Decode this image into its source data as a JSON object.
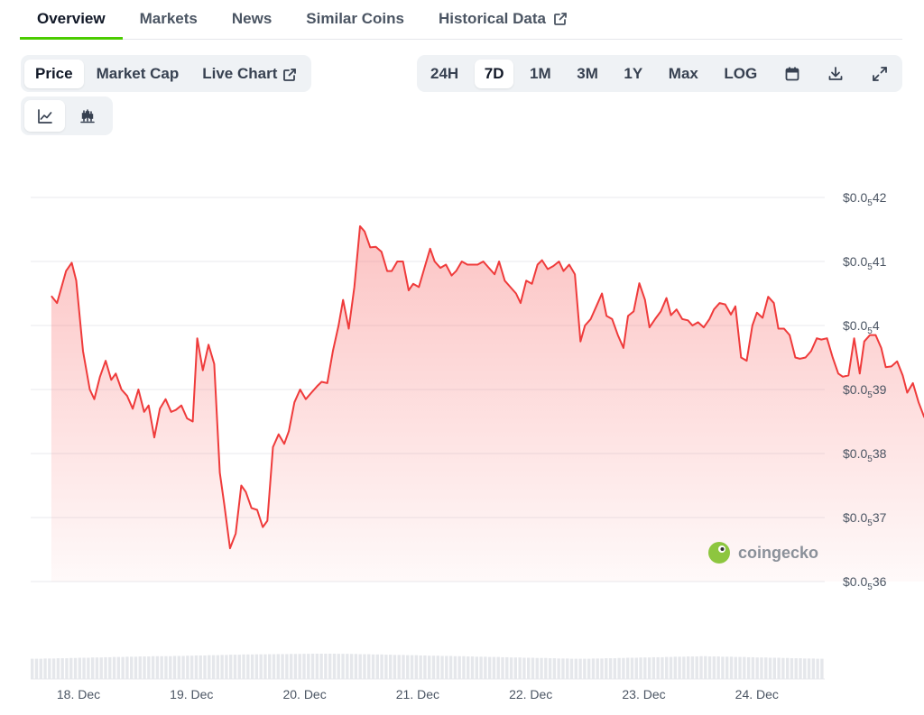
{
  "nav": {
    "tabs": [
      {
        "label": "Overview",
        "active": true
      },
      {
        "label": "Markets"
      },
      {
        "label": "News"
      },
      {
        "label": "Similar Coins"
      },
      {
        "label": "Historical Data",
        "external": true
      }
    ]
  },
  "metric_tabs": [
    {
      "label": "Price",
      "active": true
    },
    {
      "label": "Market Cap"
    },
    {
      "label": "Live Chart",
      "external": true
    }
  ],
  "range_tabs": [
    {
      "label": "24H"
    },
    {
      "label": "7D",
      "active": true
    },
    {
      "label": "1M"
    },
    {
      "label": "3M"
    },
    {
      "label": "1Y"
    },
    {
      "label": "Max"
    },
    {
      "label": "LOG"
    }
  ],
  "toolbar_icons": [
    "calendar-icon",
    "download-icon",
    "expand-icon"
  ],
  "chart_type_icons": [
    "line-chart-icon",
    "candlestick-icon"
  ],
  "colors": {
    "accent": "#4bcc00",
    "line": "#ef3b3b",
    "area": "#fde2e2"
  },
  "watermark": {
    "text": "coingecko"
  },
  "chart_data": {
    "type": "line",
    "grid": true,
    "y_tick_labels": [
      {
        "value": 4.2e-06,
        "prefix": "$0.0",
        "sub": "5",
        "suffix": "42"
      },
      {
        "value": 4.1e-06,
        "prefix": "$0.0",
        "sub": "5",
        "suffix": "41"
      },
      {
        "value": 4e-06,
        "prefix": "$0.0",
        "sub": "5",
        "suffix": "4"
      },
      {
        "value": 3.9e-06,
        "prefix": "$0.0",
        "sub": "5",
        "suffix": "39"
      },
      {
        "value": 3.8e-06,
        "prefix": "$0.0",
        "sub": "5",
        "suffix": "38"
      },
      {
        "value": 3.7e-06,
        "prefix": "$0.0",
        "sub": "5",
        "suffix": "37"
      },
      {
        "value": 3.6e-06,
        "prefix": "$0.0",
        "sub": "5",
        "suffix": "36"
      }
    ],
    "ylim": [
      3.6e-06,
      4.2e-06
    ],
    "x_tick_labels": [
      "18. Dec",
      "19. Dec",
      "20. Dec",
      "21. Dec",
      "22. Dec",
      "23. Dec",
      "24. Dec"
    ],
    "x_days_range": [
      0,
      7
    ],
    "series": [
      {
        "points": [
          [
            -0.24,
            4.046
          ],
          [
            -0.19,
            4.035
          ],
          [
            -0.11,
            4.085
          ],
          [
            -0.06,
            4.098
          ],
          [
            -0.02,
            4.07
          ],
          [
            0.04,
            3.96
          ],
          [
            0.1,
            3.9
          ],
          [
            0.14,
            3.885
          ],
          [
            0.19,
            3.92
          ],
          [
            0.24,
            3.945
          ],
          [
            0.29,
            3.915
          ],
          [
            0.33,
            3.925
          ],
          [
            0.38,
            3.9
          ],
          [
            0.43,
            3.89
          ],
          [
            0.48,
            3.87
          ],
          [
            0.53,
            3.9
          ],
          [
            0.58,
            3.865
          ],
          [
            0.62,
            3.875
          ],
          [
            0.67,
            3.825
          ],
          [
            0.72,
            3.87
          ],
          [
            0.77,
            3.885
          ],
          [
            0.82,
            3.865
          ],
          [
            0.86,
            3.868
          ],
          [
            0.91,
            3.875
          ],
          [
            0.96,
            3.855
          ],
          [
            1.01,
            3.85
          ],
          [
            1.05,
            3.98
          ],
          [
            1.1,
            3.93
          ],
          [
            1.15,
            3.97
          ],
          [
            1.2,
            3.94
          ],
          [
            1.25,
            3.77
          ],
          [
            1.29,
            3.72
          ],
          [
            1.34,
            3.652
          ],
          [
            1.39,
            3.675
          ],
          [
            1.44,
            3.75
          ],
          [
            1.48,
            3.74
          ],
          [
            1.53,
            3.715
          ],
          [
            1.58,
            3.712
          ],
          [
            1.63,
            3.685
          ],
          [
            1.67,
            3.695
          ],
          [
            1.72,
            3.81
          ],
          [
            1.77,
            3.83
          ],
          [
            1.82,
            3.815
          ],
          [
            1.86,
            3.835
          ],
          [
            1.91,
            3.88
          ],
          [
            1.96,
            3.9
          ],
          [
            2.01,
            3.885
          ],
          [
            2.06,
            3.895
          ],
          [
            2.11,
            3.905
          ],
          [
            2.15,
            3.912
          ],
          [
            2.2,
            3.91
          ],
          [
            2.25,
            3.96
          ],
          [
            2.3,
            4.0
          ],
          [
            2.34,
            4.04
          ],
          [
            2.39,
            3.995
          ],
          [
            2.44,
            4.06
          ],
          [
            2.49,
            4.155
          ],
          [
            2.53,
            4.147
          ],
          [
            2.58,
            4.122
          ],
          [
            2.63,
            4.123
          ],
          [
            2.68,
            4.115
          ],
          [
            2.73,
            4.085
          ],
          [
            2.77,
            4.085
          ],
          [
            2.82,
            4.1
          ],
          [
            2.87,
            4.1
          ],
          [
            2.92,
            4.055
          ],
          [
            2.96,
            4.065
          ],
          [
            3.01,
            4.06
          ],
          [
            3.06,
            4.09
          ],
          [
            3.11,
            4.12
          ],
          [
            3.15,
            4.1
          ],
          [
            3.2,
            4.09
          ],
          [
            3.25,
            4.095
          ],
          [
            3.3,
            4.078
          ],
          [
            3.34,
            4.085
          ],
          [
            3.39,
            4.1
          ],
          [
            3.44,
            4.095
          ],
          [
            3.49,
            4.095
          ],
          [
            3.53,
            4.095
          ],
          [
            3.58,
            4.1
          ],
          [
            3.63,
            4.09
          ],
          [
            3.68,
            4.08
          ],
          [
            3.72,
            4.1
          ],
          [
            3.77,
            4.07
          ],
          [
            3.82,
            4.06
          ],
          [
            3.87,
            4.05
          ],
          [
            3.91,
            4.035
          ],
          [
            3.96,
            4.07
          ],
          [
            4.01,
            4.065
          ],
          [
            4.06,
            4.095
          ],
          [
            4.1,
            4.102
          ],
          [
            4.15,
            4.088
          ],
          [
            4.2,
            4.093
          ],
          [
            4.25,
            4.1
          ],
          [
            4.29,
            4.085
          ],
          [
            4.34,
            4.095
          ],
          [
            4.39,
            4.08
          ],
          [
            4.44,
            3.975
          ],
          [
            4.48,
            4.0
          ],
          [
            4.53,
            4.01
          ],
          [
            4.58,
            4.03
          ],
          [
            4.63,
            4.05
          ],
          [
            4.67,
            4.015
          ],
          [
            4.72,
            4.01
          ],
          [
            4.77,
            3.985
          ],
          [
            4.82,
            3.965
          ],
          [
            4.86,
            4.015
          ],
          [
            4.91,
            4.022
          ],
          [
            4.96,
            4.066
          ],
          [
            5.01,
            4.04
          ],
          [
            5.05,
            3.997
          ],
          [
            5.1,
            4.01
          ],
          [
            5.15,
            4.022
          ],
          [
            5.2,
            4.043
          ],
          [
            5.24,
            4.016
          ],
          [
            5.29,
            4.025
          ],
          [
            5.34,
            4.01
          ],
          [
            5.39,
            4.008
          ],
          [
            5.43,
            4.0
          ],
          [
            5.48,
            4.005
          ],
          [
            5.53,
            3.997
          ],
          [
            5.58,
            4.01
          ],
          [
            5.62,
            4.025
          ],
          [
            5.67,
            4.035
          ],
          [
            5.72,
            4.033
          ],
          [
            5.77,
            4.017
          ],
          [
            5.81,
            4.03
          ],
          [
            5.86,
            3.95
          ],
          [
            5.91,
            3.945
          ],
          [
            5.96,
            4.0
          ],
          [
            6.0,
            4.02
          ],
          [
            6.05,
            4.012
          ],
          [
            6.1,
            4.045
          ],
          [
            6.15,
            4.035
          ],
          [
            6.19,
            3.995
          ],
          [
            6.24,
            3.995
          ],
          [
            6.29,
            3.985
          ],
          [
            6.34,
            3.95
          ],
          [
            6.38,
            3.948
          ],
          [
            6.43,
            3.95
          ],
          [
            6.48,
            3.96
          ],
          [
            6.53,
            3.98
          ],
          [
            6.57,
            3.978
          ],
          [
            6.62,
            3.98
          ],
          [
            6.67,
            3.95
          ],
          [
            6.72,
            3.925
          ],
          [
            6.76,
            3.92
          ],
          [
            6.81,
            3.922
          ],
          [
            6.86,
            3.98
          ],
          [
            6.91,
            3.925
          ],
          [
            6.95,
            3.975
          ],
          [
            7.0,
            3.985
          ],
          [
            7.05,
            3.985
          ],
          [
            7.1,
            3.965
          ],
          [
            7.14,
            3.935
          ],
          [
            7.19,
            3.936
          ],
          [
            7.24,
            3.944
          ],
          [
            7.29,
            3.922
          ],
          [
            7.33,
            3.895
          ],
          [
            7.38,
            3.91
          ],
          [
            7.43,
            3.88
          ],
          [
            7.48,
            3.857
          ],
          [
            7.53,
            3.865
          ],
          [
            7.57,
            3.88
          ],
          [
            7.62,
            3.875
          ],
          [
            7.67,
            3.887
          ],
          [
            7.72,
            3.912
          ],
          [
            7.76,
            3.909
          ]
        ]
      }
    ],
    "volume": {
      "n_bars": 184,
      "levels": [
        0.6,
        0.62,
        0.64,
        0.66,
        0.68,
        0.7,
        0.72,
        0.74,
        0.76,
        0.78,
        0.8,
        0.8,
        0.82,
        0.84,
        0.86,
        0.88,
        0.9,
        0.92,
        0.94,
        0.95,
        0.96,
        0.97,
        0.98,
        0.99,
        1.0,
        1.0,
        0.99,
        0.98,
        0.96,
        0.94,
        0.92,
        0.9,
        0.88,
        0.86,
        0.84,
        0.82,
        0.8,
        0.78,
        0.76,
        0.74,
        0.72,
        0.7,
        0.68,
        0.66,
        0.64,
        0.62,
        0.6,
        0.6,
        0.62,
        0.64,
        0.66,
        0.68,
        0.7,
        0.72,
        0.74,
        0.76,
        0.78,
        0.8,
        0.78,
        0.76,
        0.74,
        0.72,
        0.7,
        0.68,
        0.66,
        0.64,
        0.62,
        0.6
      ]
    }
  }
}
